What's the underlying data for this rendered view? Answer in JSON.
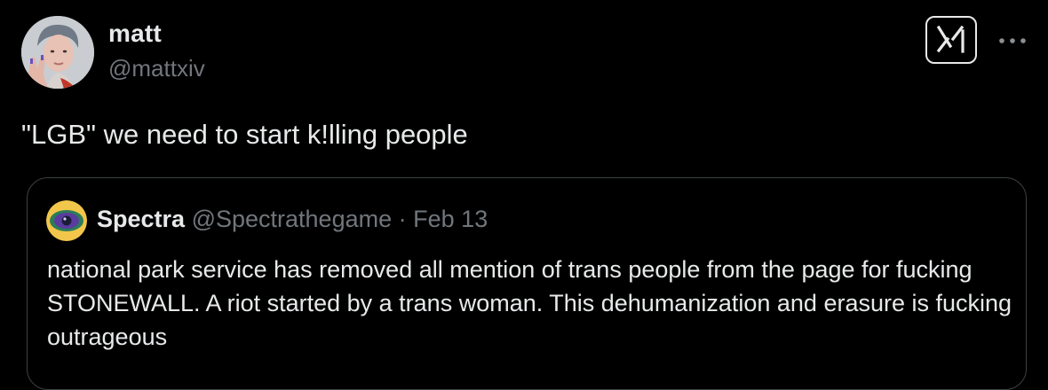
{
  "tweet": {
    "author": {
      "name": "matt",
      "handle": "@mattxiv"
    },
    "text": "\"LGB\" we need to start k!lling people",
    "icons": {
      "grok": "grok-icon",
      "more": "more-horizontal-icon"
    }
  },
  "quoted_tweet": {
    "author": {
      "name": "Spectra",
      "handle": "@Spectrathegame"
    },
    "separator": "·",
    "date": "Feb 13",
    "text": "national park service has removed all mention of trans people from the page for fucking STONEWALL. A riot started by a trans woman. This dehumanization and erasure is fucking outrageous"
  },
  "colors": {
    "background": "#000000",
    "primary_text": "#e7e9ea",
    "secondary_text": "#71767b",
    "card_border": "#3c4145"
  }
}
